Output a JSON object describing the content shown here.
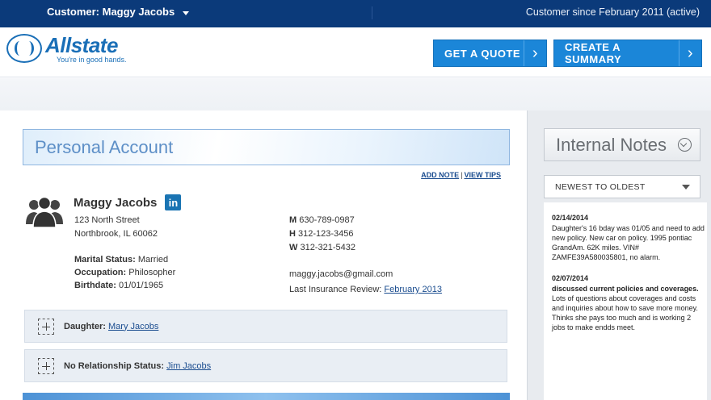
{
  "topbar": {
    "customer_label": "Customer: Maggy Jacobs",
    "since": "Customer since February 2011 (active)"
  },
  "header": {
    "logo_word": "Allstate",
    "logo_tagline": "You're in good hands.",
    "get_quote": "GET A QUOTE",
    "create_summary": "CREATE A SUMMARY"
  },
  "account": {
    "title": "Personal Account",
    "add_note": "ADD NOTE",
    "separator": "|",
    "view_tips": "VIEW TIPS",
    "name": "Maggy Jacobs",
    "linkedin_glyph": "in",
    "address_line1": "123 North Street",
    "address_line2": "Northbrook, IL 60062",
    "marital_label": "Marital Status:",
    "marital_value": "Married",
    "occupation_label": "Occupation:",
    "occupation_value": "Philosopher",
    "birthdate_label": "Birthdate:",
    "birthdate_value": "01/01/1965",
    "phone_m_label": "M",
    "phone_m": "630-789-0987",
    "phone_h_label": "H",
    "phone_h": "312-123-3456",
    "phone_w_label": "W",
    "phone_w": "312-321-5432",
    "email": "maggy.jacobs@gmail.com",
    "review_label": "Last Insurance Review:",
    "review_value": "February 2013"
  },
  "relations": [
    {
      "label": "Daughter:",
      "name": "Mary Jacobs"
    },
    {
      "label": "No Relationship Status:",
      "name": "Jim Jacobs"
    }
  ],
  "sidebar": {
    "title": "Internal Notes",
    "sort": "NEWEST TO OLDEST",
    "notes": [
      {
        "date": "02/14/2014",
        "bold": "",
        "text": "Daughter's 16 bday was 01/05 and need to add new policy. New car on policy. 1995 pontiac GrandAm. 62K miles. VIN# ZAMFE39A580035801, no alarm."
      },
      {
        "date": "02/07/2014",
        "bold": "discussed current policies and coverages.",
        "text": "Lots of questions about coverages and costs and inquiries about how to save more money. Thinks she pays too much and is working 2 jobs to make endds meet."
      }
    ]
  },
  "colors": {
    "topbar": "#0b3a7a",
    "brand_blue": "#1a6fb7",
    "button_blue": "#1b86d8",
    "link": "#1a4c8f"
  }
}
